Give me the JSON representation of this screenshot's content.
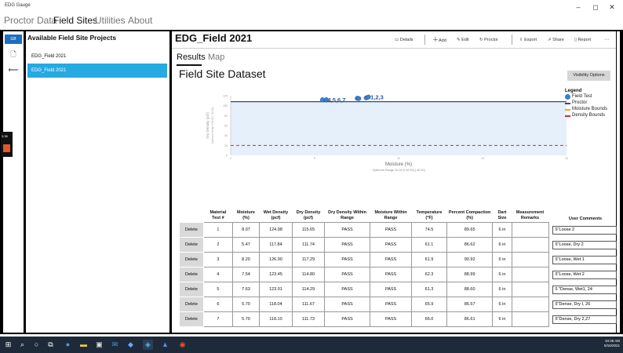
{
  "window": {
    "title": "EDG Gauge",
    "minimize": "–",
    "maximize": "◻",
    "close": "✕"
  },
  "nav_tabs": [
    "Proctor Data",
    "Field Sites",
    "Utilities",
    "About"
  ],
  "rail": {
    "selected": "GB",
    "doc_icon": "🗋",
    "back_icon": "⟵"
  },
  "side": {
    "title": "Available Field Site Projects",
    "projects": [
      "EDG_Field 2021",
      "EDG_Field 2021"
    ]
  },
  "header": {
    "title": "EDG_Field  2021",
    "toolbar": {
      "details": "Details",
      "add": "Add",
      "edit": "Edit",
      "proctor": "Proctor",
      "export": "Export",
      "share": "Share",
      "report": "Report",
      "more": "···"
    }
  },
  "subtabs": [
    "Results",
    "Map"
  ],
  "dataset_title": "Field Site Dataset",
  "visibility_button": "Visibility Options",
  "chart_data": {
    "type": "scatter",
    "ylabel": "Dry Density (pcf)",
    "ylabel2": "Optimum Range 108.00 [+10.00]",
    "xlabel": "Moisture (%)",
    "xlabel2": "Optimum Range 10.00 [+10.00] [-10.00]",
    "xlim": [
      0,
      20
    ],
    "ylim": [
      0,
      120
    ],
    "x_ticks": [
      "0",
      "5",
      "10",
      "15",
      "20"
    ],
    "y_ticks": [
      "120",
      "100",
      "80",
      "60",
      "40",
      "20",
      "0"
    ],
    "field_tests": [
      {
        "x": 8.07,
        "y": 115.65
      },
      {
        "x": 5.47,
        "y": 111.74
      },
      {
        "x": 8.2,
        "y": 117.29
      },
      {
        "x": 7.54,
        "y": 114.8
      },
      {
        "x": 7.63,
        "y": 114.29
      },
      {
        "x": 5.7,
        "y": 111.67
      },
      {
        "x": 5.7,
        "y": 111.73
      }
    ],
    "point_labels": [
      "1,2,3",
      "4,5,6,7"
    ],
    "proctor_curve": {
      "x": [
        0,
        10,
        20
      ],
      "y": [
        108,
        108,
        108
      ]
    },
    "density_bound": 20,
    "legend": {
      "title": "Legend",
      "items": [
        {
          "label": "Field Test",
          "color": "#3a7fd5",
          "shape": "circle"
        },
        {
          "label": "Proctor",
          "color": "#3b4a6b",
          "shape": "line"
        },
        {
          "label": "Moisture Bounds",
          "color": "#f2b100",
          "shape": "line"
        },
        {
          "label": "Density Bounds",
          "color": "#e0262b",
          "shape": "line"
        }
      ]
    },
    "fill_color": "#e6f0fa"
  },
  "table": {
    "headers": [
      "",
      "Material Test #",
      "Moisture (%)",
      "Wet Density (pcf)",
      "Dry Density (pcf)",
      "Dry Density Within Range",
      "Moisture Within Range",
      "Temperature (°F)",
      "Percent Compaction (%)",
      "Dart Size",
      "Measurement Remarks",
      "User Comments"
    ],
    "delete_label": "Delete",
    "rows": [
      {
        "test": "1",
        "moisture": "8.07",
        "wet": "124.98",
        "dry": "115.65",
        "dd_range": "PASS",
        "m_range": "PASS",
        "temp": "74.5",
        "pc": "89.65",
        "dart": "6 in",
        "remarks": "",
        "comment": "6\"Loose 2"
      },
      {
        "test": "2",
        "moisture": "5.47",
        "wet": "117.84",
        "dry": "111.74",
        "dd_range": "PASS",
        "m_range": "PASS",
        "temp": "61.1",
        "pc": "86.62",
        "dart": "6 in",
        "remarks": "",
        "comment": "6\"Loose, Dry 2"
      },
      {
        "test": "3",
        "moisture": "8.20",
        "wet": "126.90",
        "dry": "117.29",
        "dd_range": "PASS",
        "m_range": "PASS",
        "temp": "61.9",
        "pc": "90.92",
        "dart": "6 in",
        "remarks": "",
        "comment": "6\"Loose, Wet 1"
      },
      {
        "test": "4",
        "moisture": "7.54",
        "wet": "123.45",
        "dry": "114.80",
        "dd_range": "PASS",
        "m_range": "PASS",
        "temp": "62.3",
        "pc": "88.99",
        "dart": "6 in",
        "remarks": "",
        "comment": "6\"Loose, Wet 2"
      },
      {
        "test": "5",
        "moisture": "7.63",
        "wet": "123.01",
        "dry": "114.29",
        "dd_range": "PASS",
        "m_range": "PASS",
        "temp": "61.3",
        "pc": "88.60",
        "dart": "6 in",
        "remarks": "",
        "comment": "6 \"Dense, Wet1, 24"
      },
      {
        "test": "6",
        "moisture": "5.70",
        "wet": "118.04",
        "dry": "111.67",
        "dd_range": "PASS",
        "m_range": "PASS",
        "temp": "65.9",
        "pc": "86.57",
        "dart": "6 in",
        "remarks": "",
        "comment": "6\"Dense, Dry I, 26"
      },
      {
        "test": "7",
        "moisture": "5.70",
        "wet": "118.10",
        "dry": "111.73",
        "dd_range": "PASS",
        "m_range": "PASS",
        "temp": "66.0",
        "pc": "86.61",
        "dart": "6 in",
        "remarks": "",
        "comment": "6\"Dense, Dry 2,27"
      }
    ]
  },
  "float_widget": {
    "time": "3:38"
  },
  "taskbar": {
    "time": "10:35 AM",
    "date": "5/16/2021"
  }
}
